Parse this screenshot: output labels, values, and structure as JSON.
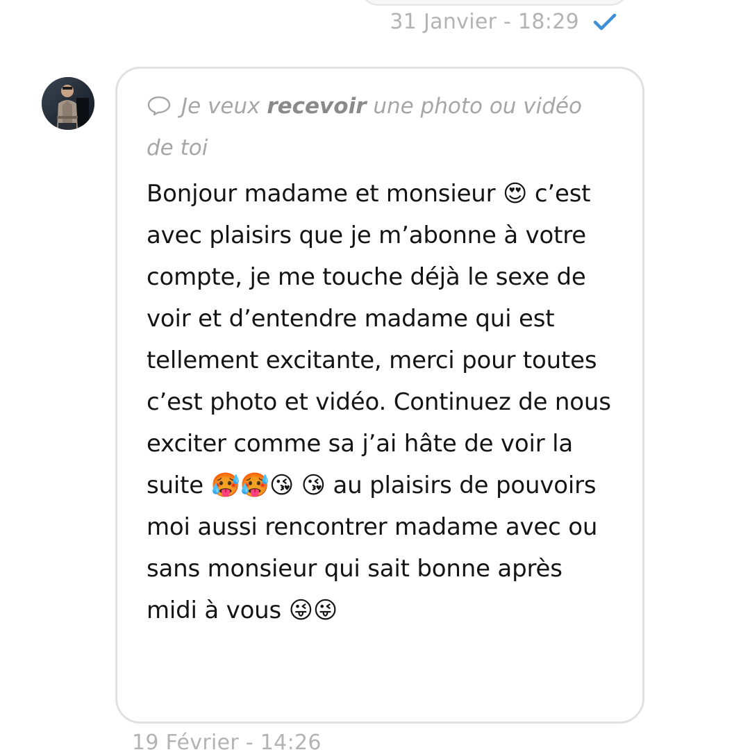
{
  "previous_message": {
    "timestamp": "31 Janvier - 18:29",
    "status_icon": "check-icon",
    "status_color": "#3d8fd6"
  },
  "message": {
    "avatar_icon": "user-avatar",
    "request_icon": "chat-bubble-icon",
    "request_prefix": "Je veux ",
    "request_bold": "recevoir",
    "request_suffix": " une photo ou vidéo de toi",
    "body": "Bonjour madame et monsieur 😍 c’est avec plaisirs que je m’abonne à votre compte, je me touche déjà le sexe de voir et d’entendre madame qui est tellement excitante, merci pour toutes c’est photo et vidéo. Continuez de nous exciter comme sa j’ai hâte de voir la suite 🥵🥵😘 😘 au plaisirs de pouvoirs moi aussi rencontrer madame avec ou sans monsieur qui sait bonne après midi à vous 😜😜"
  },
  "next_message": {
    "timestamp": "19 Février - 14:26"
  },
  "colors": {
    "bubble_border": "#e1e1e1",
    "text": "#141414",
    "muted": "#a6a6a6"
  }
}
